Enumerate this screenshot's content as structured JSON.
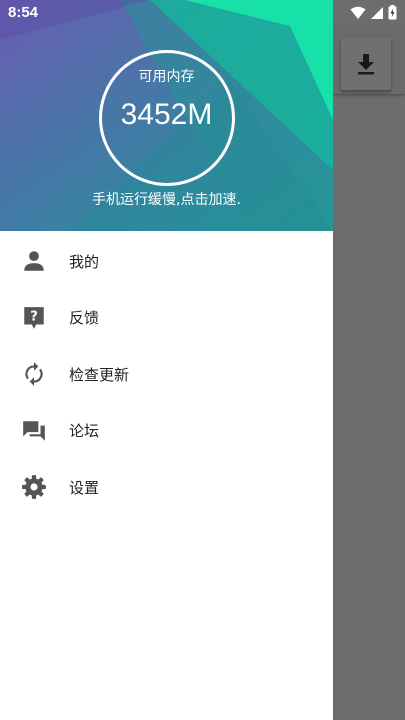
{
  "status_bar": {
    "time": "8:54",
    "icons": [
      "wifi-icon",
      "cell-signal-icon",
      "battery-charging-icon"
    ]
  },
  "header": {
    "memory_label": "可用内存",
    "memory_value": "3452M",
    "speed_hint": "手机运行缓慢,点击加速."
  },
  "menu": {
    "items": [
      {
        "label": "我的",
        "icon": "person-icon"
      },
      {
        "label": "反馈",
        "icon": "feedback-icon"
      },
      {
        "label": "检查更新",
        "icon": "refresh-icon"
      },
      {
        "label": "论坛",
        "icon": "forum-icon"
      },
      {
        "label": "设置",
        "icon": "gear-icon"
      }
    ]
  },
  "toolbar": {
    "download_icon": "download-icon"
  },
  "colors": {
    "header_gradient_start": "#6a5fb0",
    "header_gradient_end": "#1fb4a0",
    "header_accent": "#17e0a8",
    "icon_gray": "#555555",
    "scrim": "#6d6d6d"
  }
}
